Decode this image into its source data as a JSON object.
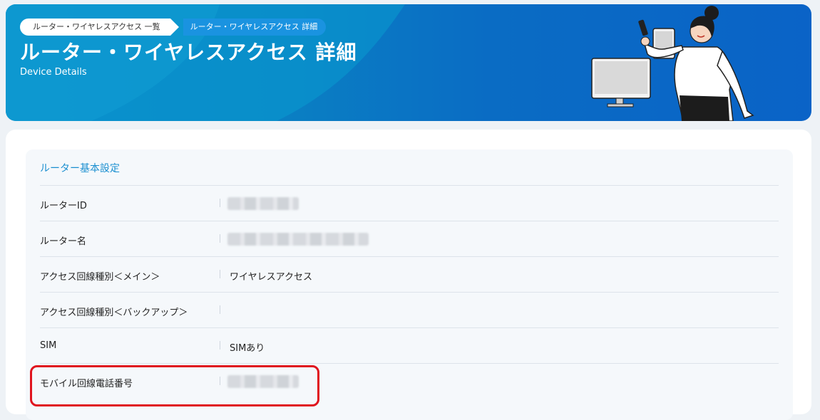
{
  "breadcrumb": {
    "parent": "ルーター・ワイヤレスアクセス 一覧",
    "current": "ルーター・ワイヤレスアクセス 詳細"
  },
  "header": {
    "title": "ルーター・ワイヤレスアクセス 詳細",
    "subtitle": "Device Details"
  },
  "section": {
    "title": "ルーター基本設定",
    "rows": [
      {
        "label": "ルーターID",
        "value": ""
      },
      {
        "label": "ルーター名",
        "value": ""
      },
      {
        "label": "アクセス回線種別＜メイン＞",
        "value": "ワイヤレスアクセス"
      },
      {
        "label": "アクセス回線種別＜バックアップ＞",
        "value": ""
      },
      {
        "label": "SIM",
        "value": "SIMあり"
      },
      {
        "label": "モバイル回線電話番号",
        "value": ""
      }
    ]
  },
  "colors": {
    "accent": "#1b8fd0",
    "highlight": "#e0141e",
    "hero": "#0a6cc4"
  }
}
